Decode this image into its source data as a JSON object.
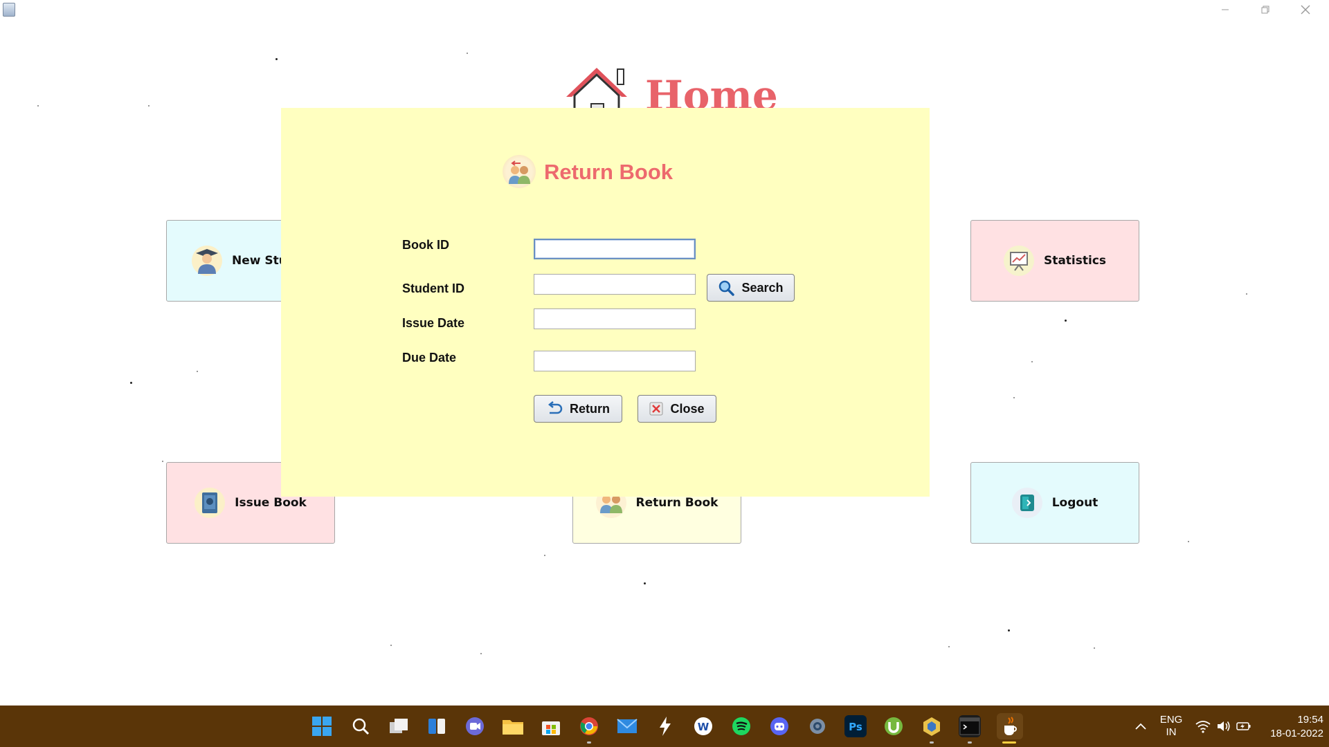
{
  "window": {
    "minimize_icon": "minimize-icon",
    "restore_icon": "restore-icon",
    "close_icon": "close-icon"
  },
  "home": {
    "title": "Home"
  },
  "tiles": {
    "new_student": "New Stu",
    "statistics": "Statistics",
    "issue_book": "Issue Book",
    "return_book": "Return Book",
    "logout": "Logout"
  },
  "dialog": {
    "title": "Return Book",
    "fields": {
      "book_id_label": "Book ID",
      "book_id_value": "",
      "student_id_label": "Student ID",
      "student_id_value": "",
      "issue_date_label": "Issue Date",
      "issue_date_value": "",
      "due_date_label": "Due Date",
      "due_date_value": ""
    },
    "buttons": {
      "search": "Search",
      "return": "Return",
      "close": "Close"
    }
  },
  "taskbar": {
    "apps": [
      "start",
      "search",
      "task-view",
      "widgets",
      "teams",
      "file-explorer",
      "microsoft-store",
      "chrome",
      "mail",
      "app",
      "app",
      "spotify",
      "discord",
      "settings",
      "photoshop",
      "utorrent",
      "app",
      "terminal",
      "java"
    ],
    "tray": {
      "language_line1": "ENG",
      "language_line2": "IN",
      "time": "19:54",
      "date": "18-01-2022"
    }
  },
  "colors": {
    "dialog_bg": "#ffffc0",
    "accent_title": "#ed6a6e",
    "taskbar_bg": "#5a3508",
    "tile_blue": "#e4fbfd",
    "tile_pink": "#ffe1e3",
    "tile_yellow": "#ffffe0"
  }
}
